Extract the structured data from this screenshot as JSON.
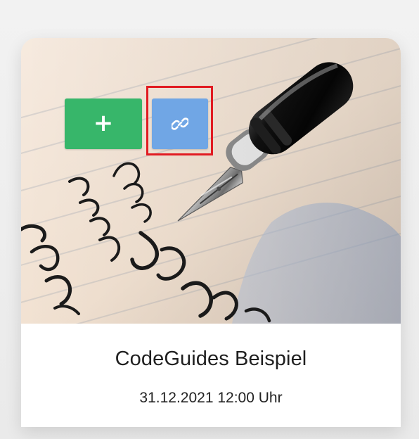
{
  "card": {
    "title": "CodeGuides Beispiel",
    "date": "31.12.2021 12:00 Uhr",
    "image_subject": "fountain pen writing on lined paper"
  },
  "actions": {
    "add_button": {
      "icon": "plus-icon",
      "color": "#37b66a"
    },
    "link_button": {
      "icon": "link-icon",
      "color": "#70a6e5"
    }
  },
  "highlight": {
    "color": "#e11b22"
  }
}
